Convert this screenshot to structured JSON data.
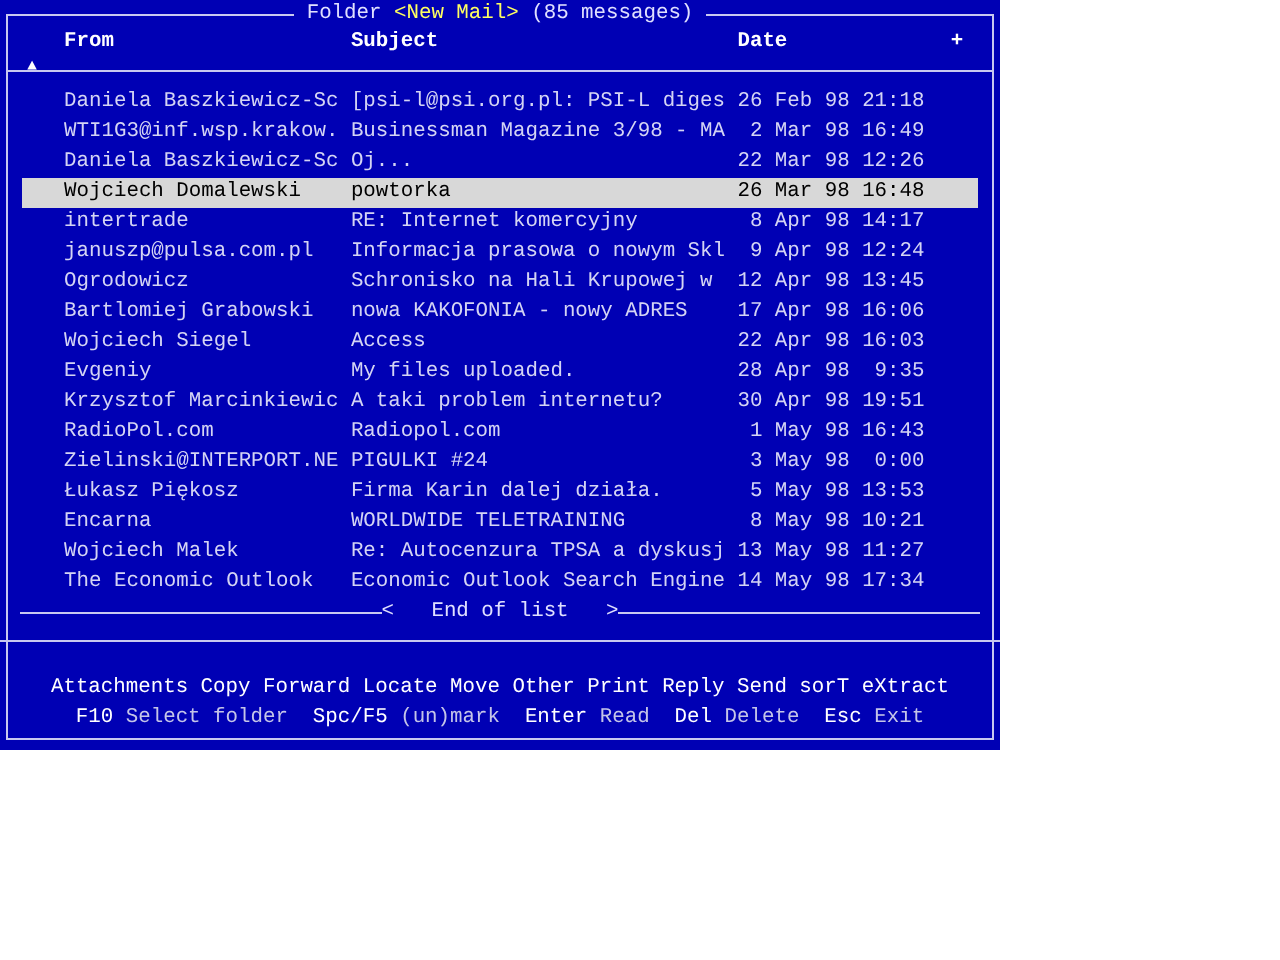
{
  "title": {
    "prefix": "Folder",
    "folder": "<New Mail>",
    "count": "(85 messages)"
  },
  "columns": [
    {
      "label": "From"
    },
    {
      "label": "Subject"
    },
    {
      "label": "Date"
    }
  ],
  "header_mark": "+",
  "scroll_mark": "▲",
  "messages": [
    {
      "from": "Daniela Baszkiewicz-Sc",
      "subject": "[psi-l@psi.org.pl: PSI-L diges",
      "date": "26 Feb 98 21:18",
      "selected": false
    },
    {
      "from": "WTI1G3@inf.wsp.krakow.",
      "subject": "Businessman Magazine 3/98 - MA",
      "date": "2 Mar 98 16:49",
      "selected": false
    },
    {
      "from": "Daniela Baszkiewicz-Sc",
      "subject": "Oj...",
      "date": "22 Mar 98 12:26",
      "selected": false
    },
    {
      "from": "Wojciech Domalewski",
      "subject": "powtorka",
      "date": "26 Mar 98 16:48",
      "selected": true
    },
    {
      "from": "intertrade",
      "subject": "RE: Internet komercyjny",
      "date": "8 Apr 98 14:17",
      "selected": false
    },
    {
      "from": "januszp@pulsa.com.pl",
      "subject": "Informacja prasowa o nowym Skl",
      "date": "9 Apr 98 12:24",
      "selected": false
    },
    {
      "from": "Ogrodowicz",
      "subject": "Schronisko na Hali Krupowej w",
      "date": "12 Apr 98 13:45",
      "selected": false
    },
    {
      "from": "Bartlomiej Grabowski",
      "subject": "nowa KAKOFONIA - nowy ADRES",
      "date": "17 Apr 98 16:06",
      "selected": false
    },
    {
      "from": "Wojciech Siegel",
      "subject": "Access",
      "date": "22 Apr 98 16:03",
      "selected": false
    },
    {
      "from": "Evgeniy",
      "subject": "My files uploaded.",
      "date": "28 Apr 98  9:35",
      "selected": false
    },
    {
      "from": "Krzysztof Marcinkiewic",
      "subject": "A taki problem internetu?",
      "date": "30 Apr 98 19:51",
      "selected": false
    },
    {
      "from": "RadioPol.com",
      "subject": "Radiopol.com",
      "date": "1 May 98 16:43",
      "selected": false
    },
    {
      "from": "Zielinski@INTERPORT.NE",
      "subject": "PIGULKI #24",
      "date": "3 May 98  0:00",
      "selected": false
    },
    {
      "from": "Łukasz Piękosz",
      "subject": "Firma Karin dalej działa.",
      "date": "5 May 98 13:53",
      "selected": false
    },
    {
      "from": "Encarna",
      "subject": "WORLDWIDE TELETRAINING",
      "date": "8 May 98 10:21",
      "selected": false
    },
    {
      "from": "Wojciech Malek",
      "subject": "Re: Autocenzura TPSA a dyskusj",
      "date": "13 May 98 11:27",
      "selected": false
    },
    {
      "from": "The Economic Outlook",
      "subject": "Economic Outlook Search Engine",
      "date": "14 May 98 17:34",
      "selected": false
    }
  ],
  "end_of_list": {
    "open": "<",
    "label": "End of list",
    "close": ">"
  },
  "commands": [
    "Attachments",
    "Copy",
    "Forward",
    "Locate",
    "Move",
    "Other",
    "Print",
    "Reply",
    "Send",
    "sorT",
    "eXtract"
  ],
  "keys": [
    {
      "key": "F10",
      "label": "Select folder"
    },
    {
      "key": "Spc/F5",
      "label": "(un)mark"
    },
    {
      "key": "Enter",
      "label": "Read"
    },
    {
      "key": "Del",
      "label": "Delete"
    },
    {
      "key": "Esc",
      "label": "Exit"
    }
  ]
}
